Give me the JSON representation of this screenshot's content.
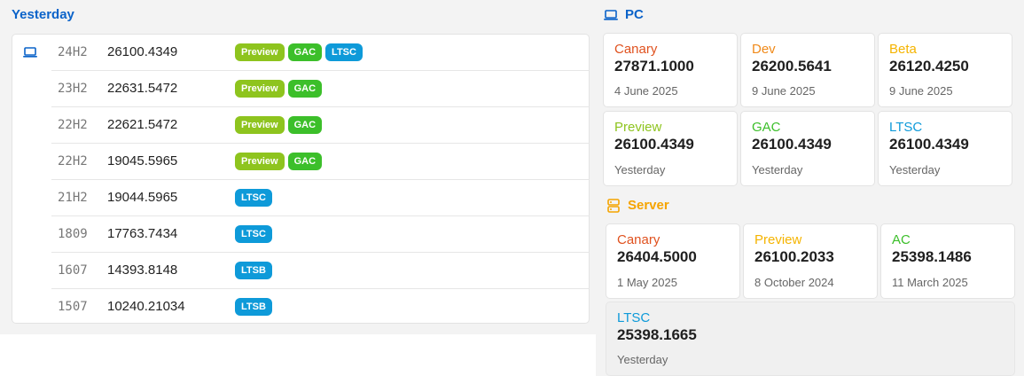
{
  "colors": {
    "accent_blue": "#0b63c9",
    "server_yellow": "#f5a400",
    "canary": "#e0521f",
    "dev": "#f08a1a",
    "beta": "#f5b400",
    "preview": "#8ec41e",
    "gac": "#3cbf2a",
    "ltsc": "#0e9ad9",
    "ltsb": "#0e9ad9"
  },
  "history": {
    "title": "Yesterday",
    "device_icon": "laptop-icon",
    "rows": [
      {
        "version": "24H2",
        "build": "26100.4349",
        "badges": [
          "Preview",
          "GAC",
          "LTSC"
        ]
      },
      {
        "version": "23H2",
        "build": "22631.5472",
        "badges": [
          "Preview",
          "GAC"
        ]
      },
      {
        "version": "22H2",
        "build": "22621.5472",
        "badges": [
          "Preview",
          "GAC"
        ]
      },
      {
        "version": "22H2",
        "build": "19045.5965",
        "badges": [
          "Preview",
          "GAC"
        ]
      },
      {
        "version": "21H2",
        "build": "19044.5965",
        "badges": [
          "LTSC"
        ]
      },
      {
        "version": "1809",
        "build": "17763.7434",
        "badges": [
          "LTSC"
        ]
      },
      {
        "version": "1607",
        "build": "14393.8148",
        "badges": [
          "LTSB"
        ]
      },
      {
        "version": "1507",
        "build": "10240.21034",
        "badges": [
          "LTSB"
        ]
      }
    ]
  },
  "pc": {
    "title": "PC",
    "icon": "laptop-icon",
    "tiles": [
      {
        "channel": "Canary",
        "build": "27871.1000",
        "date": "4 June 2025",
        "color": "#e0521f"
      },
      {
        "channel": "Dev",
        "build": "26200.5641",
        "date": "9 June 2025",
        "color": "#f08a1a"
      },
      {
        "channel": "Beta",
        "build": "26120.4250",
        "date": "9 June 2025",
        "color": "#f5b400"
      },
      {
        "channel": "Preview",
        "build": "26100.4349",
        "date": "Yesterday",
        "color": "#8ec41e"
      },
      {
        "channel": "GAC",
        "build": "26100.4349",
        "date": "Yesterday",
        "color": "#3cbf2a"
      },
      {
        "channel": "LTSC",
        "build": "26100.4349",
        "date": "Yesterday",
        "color": "#0e9ad9"
      }
    ]
  },
  "server": {
    "title": "Server",
    "icon": "server-icon",
    "tiles": [
      {
        "channel": "Canary",
        "build": "26404.5000",
        "date": "1 May 2025",
        "color": "#e0521f"
      },
      {
        "channel": "Preview",
        "build": "26100.2033",
        "date": "8 October 2024",
        "color": "#f5b400"
      },
      {
        "channel": "AC",
        "build": "25398.1486",
        "date": "11 March 2025",
        "color": "#3cbf2a"
      },
      {
        "channel": "LTSC",
        "build": "25398.1665",
        "date": "Yesterday",
        "color": "#0e9ad9"
      }
    ]
  }
}
